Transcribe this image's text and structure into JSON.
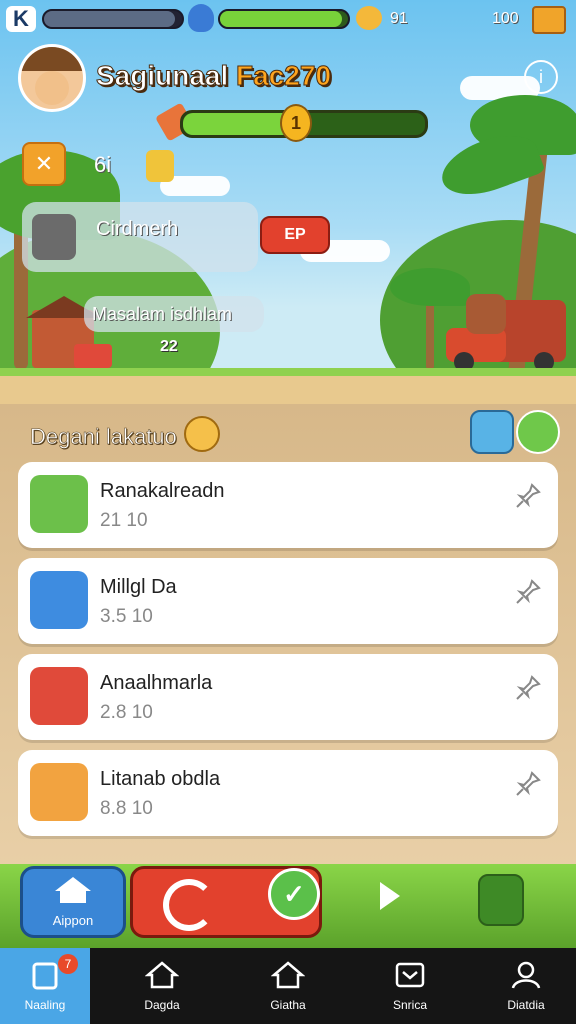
{
  "topbar": {
    "logo_letter": "K",
    "counter_left": "91",
    "coins": "100",
    "energy_fill": 0.95,
    "green_fill": 0.95
  },
  "player": {
    "name_part1": "Sagiunaal",
    "name_part2": "Fac270",
    "xp_fill": 0.45,
    "level_badge": "1",
    "gem_count": "6i"
  },
  "notices": [
    {
      "text": "Cirdmerh",
      "badge": "ЕР"
    },
    {
      "text": "Masalam isdhlam",
      "badge": "22"
    }
  ],
  "section": {
    "title": "Degani lakatuo"
  },
  "list": [
    {
      "name": "Ranakalreadn",
      "meta": "21 10",
      "thumb_color": "#6cc04a"
    },
    {
      "name": "Millgl Da",
      "meta": "3.5 10",
      "thumb_color": "#3e8ce0"
    },
    {
      "name": "Anaalhmarla",
      "meta": "2.8 10",
      "thumb_color": "#e04a3a"
    },
    {
      "name": "Litanab obdla",
      "meta": "8.8 10",
      "thumb_color": "#f2a340"
    }
  ],
  "actions": {
    "home_label": "Aippon"
  },
  "nav": {
    "items": [
      {
        "label": "Naaling",
        "badge": "7"
      },
      {
        "label": "Dagda"
      },
      {
        "label": "Giatha"
      },
      {
        "label": "Snrica"
      },
      {
        "label": "Diatdia"
      }
    ]
  },
  "colors": {
    "accent": "#ffa51f",
    "primary_green": "#7bd43c",
    "red": "#e0402a",
    "blue": "#3e86d8"
  }
}
